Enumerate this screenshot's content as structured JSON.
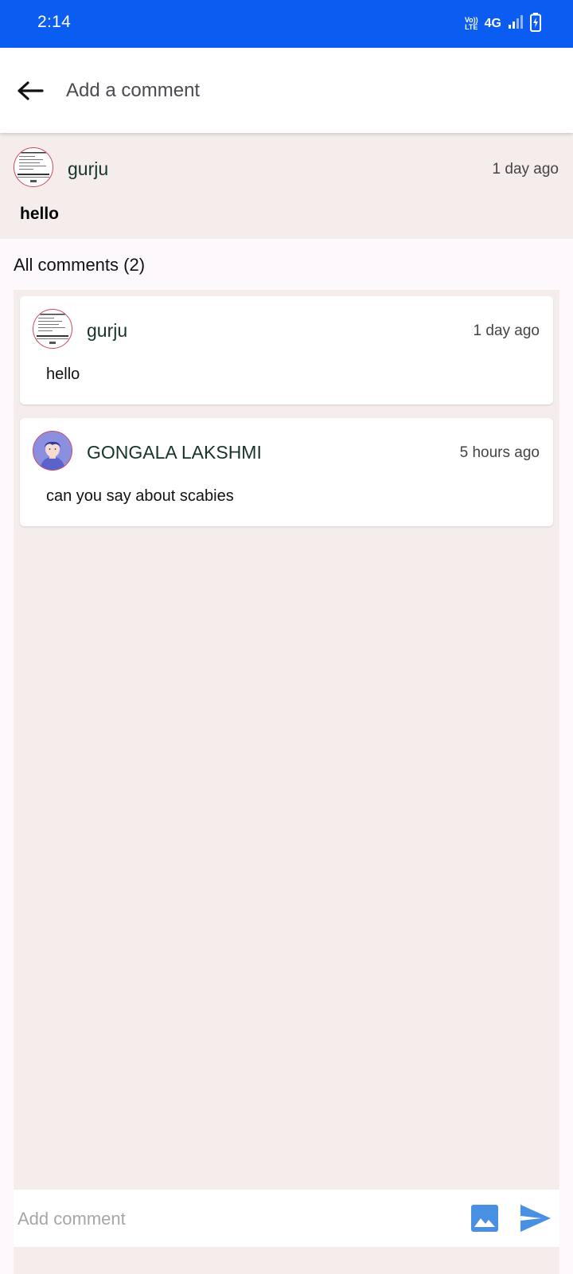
{
  "status_bar": {
    "time": "2:14",
    "volte_top": "Vo))",
    "volte_bottom": "LTE",
    "network": "4G",
    "icons": [
      "volte-icon",
      "signal-icon",
      "battery-charging-icon"
    ]
  },
  "header": {
    "title": "Add a comment",
    "back_icon": "arrow-left-icon"
  },
  "post": {
    "author": "gurju",
    "time": "1 day ago",
    "text": "hello"
  },
  "comments_section": {
    "heading": "All comments (2)",
    "comments": [
      {
        "author": "gurju",
        "time": "1 day ago",
        "text": "hello"
      },
      {
        "author": "GONGALA LAKSHMI",
        "time": "5 hours ago",
        "text": "can you say about scabies"
      }
    ]
  },
  "input": {
    "placeholder": "Add comment",
    "image_icon": "image-icon",
    "send_icon": "send-icon"
  },
  "colors": {
    "status_bar": "#0b5cf0",
    "accent": "#4a90e2",
    "panel": "#f5edec"
  }
}
